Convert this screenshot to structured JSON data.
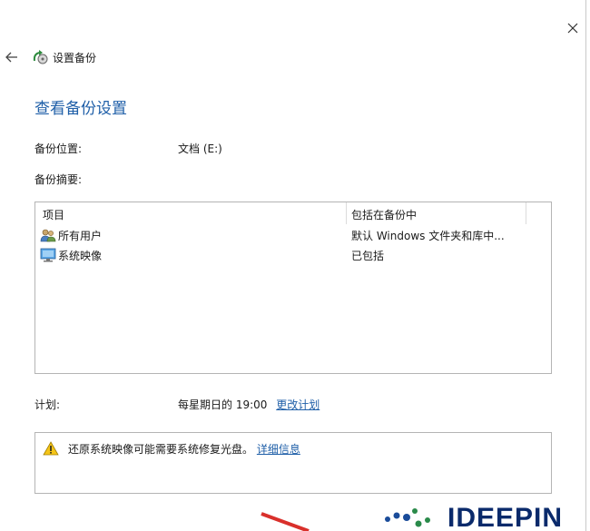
{
  "window": {
    "title": "设置备份",
    "close_icon": "close-icon",
    "back_icon": "back-arrow-icon",
    "app_icon": "backup-icon"
  },
  "page": {
    "title": "查看备份设置"
  },
  "backup_location": {
    "label": "备份位置:",
    "value": "文档 (E:)"
  },
  "backup_summary": {
    "label": "备份摘要:"
  },
  "table": {
    "columns": [
      "项目",
      "包括在备份中"
    ],
    "rows": [
      {
        "icon": "users-icon",
        "item": "所有用户",
        "included": "默认 Windows 文件夹和库中..."
      },
      {
        "icon": "monitor-icon",
        "item": "系统映像",
        "included": "已包括"
      }
    ]
  },
  "schedule": {
    "label": "计划:",
    "value": "每星期日的 19:00",
    "change_link": "更改计划"
  },
  "warning": {
    "icon": "warning-icon",
    "text": "还原系统映像可能需要系统修复光盘。",
    "link": "详细信息"
  },
  "watermark": {
    "text": "IDEEPIN"
  },
  "colors": {
    "accent": "#1f5fa8",
    "border": "#b4b4b4",
    "watermark": "#0a2a6b"
  }
}
